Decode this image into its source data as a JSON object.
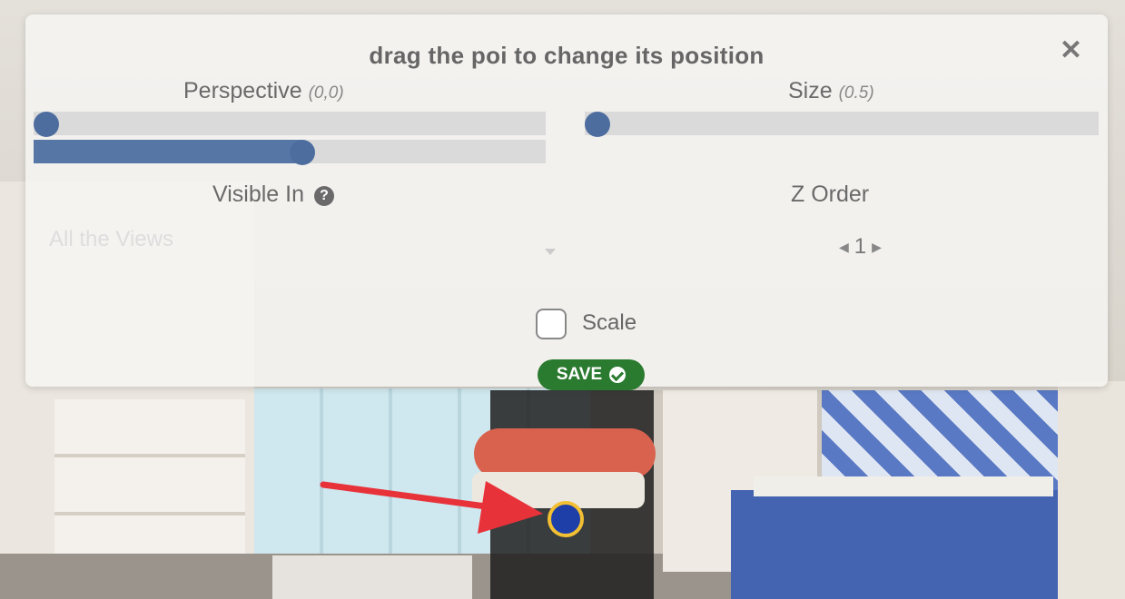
{
  "dialog": {
    "title": "drag the poi to change its position",
    "close_symbol": "✕"
  },
  "perspective": {
    "label": "Perspective",
    "value": "(0,0)",
    "slider_x_level": 0.0,
    "slider_y_level": 0.5
  },
  "size": {
    "label": "Size",
    "value": "(0.5)",
    "slider_level": 0.0
  },
  "visible_in": {
    "label": "Visible In",
    "help_symbol": "?",
    "selected": "All the Views"
  },
  "z_order": {
    "label": "Z Order",
    "value": "1",
    "decrease_symbol": "◀",
    "increase_symbol": "▶"
  },
  "scale": {
    "label": "Scale",
    "checked": false
  },
  "save": {
    "label": "SAVE"
  },
  "colors": {
    "slider_fill": "#5677a6",
    "slider_track": "#dadada",
    "save_green": "#2a7a2f",
    "poi_blue": "#1f3fa8",
    "poi_ring": "#f2c032",
    "arrow_red": "#e8323a"
  },
  "icons": {
    "close": "close-icon",
    "help": "help-circle-icon",
    "save_check": "check-circle-icon",
    "poi": "poi-marker-icon"
  }
}
